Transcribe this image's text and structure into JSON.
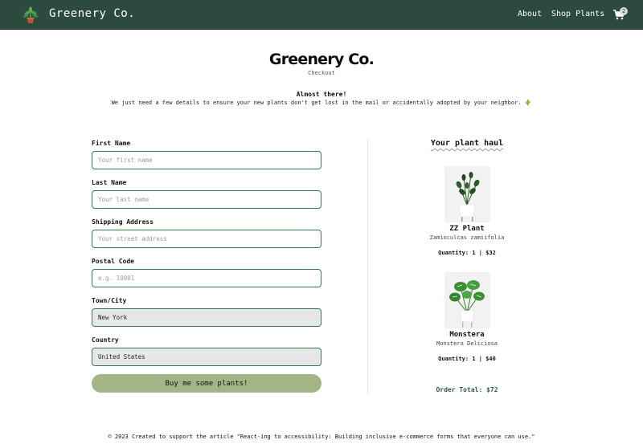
{
  "nav": {
    "brand": "Greenery Co.",
    "links": [
      "About",
      "Shop Plants"
    ],
    "cart_count": "2"
  },
  "header": {
    "title": "Greenery Co.",
    "subtitle": "Checkout",
    "intro_heading": "Almost there!",
    "intro_text": "We just need a few details to ensure your new plants don't get lost in the mail or accidentally adopted by your neighbor. 🌵"
  },
  "form": {
    "first_name": {
      "label": "First Name",
      "placeholder": "Your first name",
      "value": ""
    },
    "last_name": {
      "label": "Last Name",
      "placeholder": "Your last name",
      "value": ""
    },
    "address": {
      "label": "Shipping Address",
      "placeholder": "Your street address",
      "value": ""
    },
    "postal": {
      "label": "Postal Code",
      "placeholder": "e.g. 10001",
      "value": ""
    },
    "city": {
      "label": "Town/City",
      "placeholder": "",
      "value": "New York"
    },
    "country": {
      "label": "Country",
      "placeholder": "",
      "value": "United States"
    },
    "submit_label": "Buy me some plants!"
  },
  "haul": {
    "title": "Your plant haul",
    "items": [
      {
        "name": "ZZ Plant",
        "latin": "Zamioculcas zamiifolia",
        "qty": "Quantity: 1 | $32"
      },
      {
        "name": "Monstera",
        "latin": "Monstera Deliciosa",
        "qty": "Quantity: 1 | $40"
      }
    ],
    "total": "Order Total: $72"
  },
  "footer": {
    "text": "© 2023 Created to support the article \"React-ing to accessibility: Building inclusive e-commerce forms that everyone can use.\""
  },
  "colors": {
    "nav_bg": "#2d4a3e",
    "input_border": "#3b7a48",
    "button_bg": "#a3b487",
    "total_text": "#2d5b3e"
  },
  "icons": [
    "plant-logo-icon",
    "cart-icon"
  ]
}
